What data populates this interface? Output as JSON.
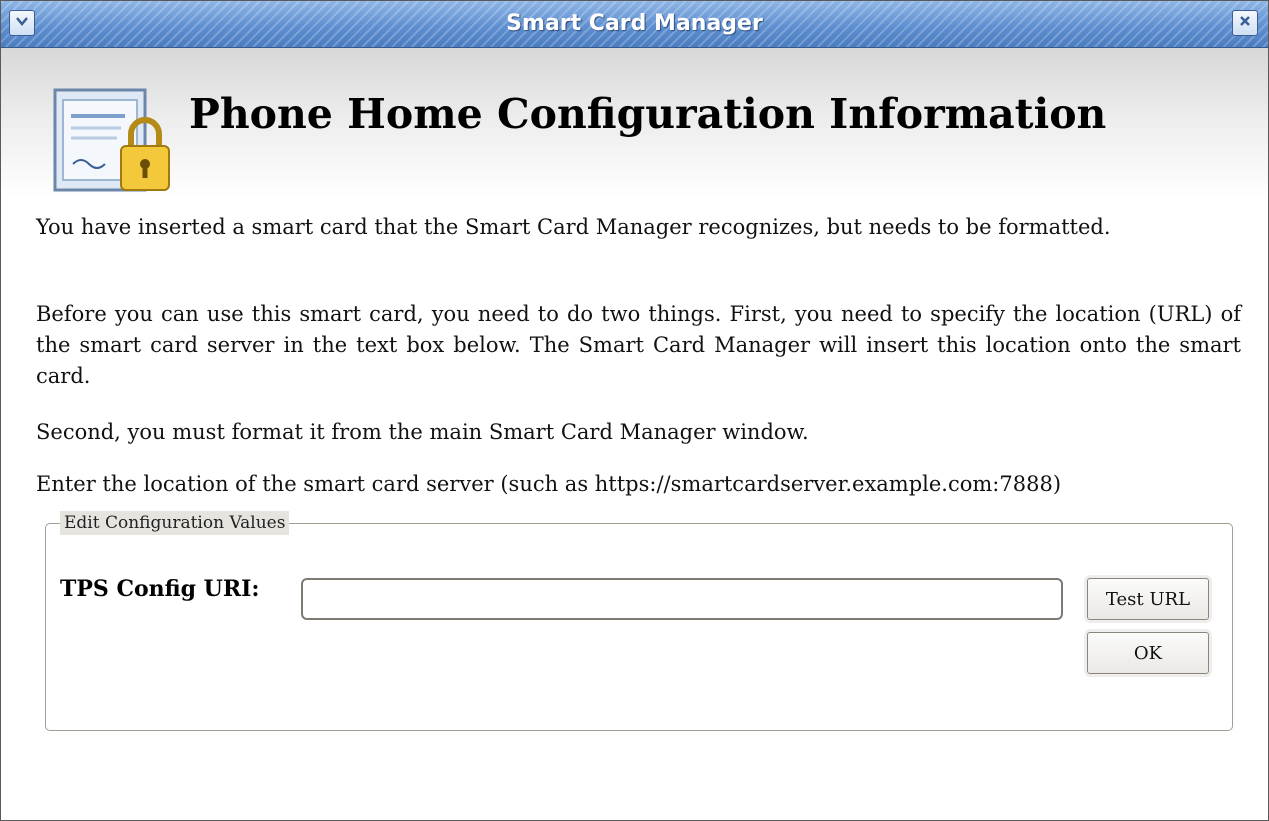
{
  "window": {
    "title": "Smart Card Manager",
    "menu_icon": "chevron-down-icon",
    "close_icon": "close-icon",
    "menu_glyph": "⌄",
    "close_glyph": "✕"
  },
  "header": {
    "title": "Phone Home Configuration Information",
    "icon": "certificate-lock-icon"
  },
  "body": {
    "paragraph1": "You have inserted a smart card that the Smart Card Manager recognizes, but needs to be formatted.",
    "paragraph2": "Before you can use this smart card, you need to do two things. First, you need to specify the location (URL) of the smart card server in the text box below. The Smart Card Manager will insert this location onto the smart card.",
    "paragraph3": "Second, you must format it from the main Smart Card Manager window.",
    "paragraph4": "Enter the location of the smart card server (such as https://smartcardserver.example.com:7888)"
  },
  "config_group": {
    "legend": "Edit Configuration Values",
    "uri_label": "TPS Config URI:",
    "uri_value": "",
    "test_button": "Test URL",
    "ok_button": "OK"
  },
  "colors": {
    "titlebar": "#5e8fd0",
    "title_text": "#ffffff",
    "group_border": "#a39e94"
  }
}
